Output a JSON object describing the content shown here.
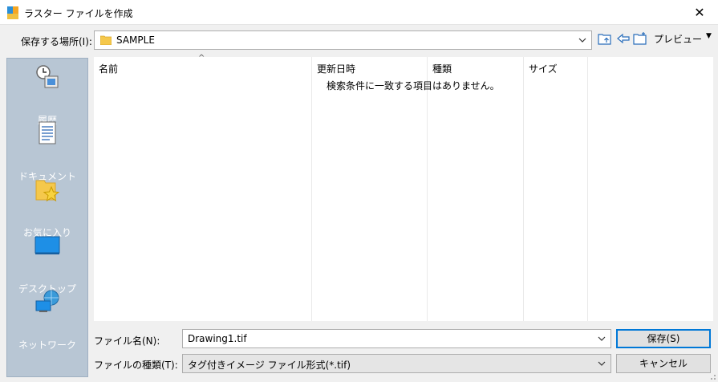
{
  "window": {
    "title": "ラスター ファイルを作成",
    "close_glyph": "✕"
  },
  "location": {
    "label": "保存する場所(I):",
    "value": "SAMPLE"
  },
  "toolbar": {
    "preview_label": "プレビュー",
    "preview_arrow": "▼"
  },
  "places": [
    {
      "label": "履歴",
      "icon": "history-icon"
    },
    {
      "label": "ドキュメント",
      "icon": "documents-icon"
    },
    {
      "label": "お気に入り",
      "icon": "favorites-icon"
    },
    {
      "label": "デスクトップ",
      "icon": "desktop-icon"
    },
    {
      "label": "ネットワーク",
      "icon": "network-icon"
    }
  ],
  "filelist": {
    "columns": [
      "名前",
      "更新日時",
      "種類",
      "サイズ"
    ],
    "sort_indicator": "^",
    "empty_message": "検索条件に一致する項目はありません。"
  },
  "filename": {
    "label": "ファイル名(N):",
    "value": "Drawing1.tif"
  },
  "filetype": {
    "label": "ファイルの種類(T):",
    "value": "タグ付きイメージ ファイル形式(*.tif)"
  },
  "buttons": {
    "save": "保存(S)",
    "cancel": "キャンセル"
  },
  "colors": {
    "places_bg": "#b8c6d4",
    "accent": "#0078d7",
    "folder": "#f5c84c"
  }
}
